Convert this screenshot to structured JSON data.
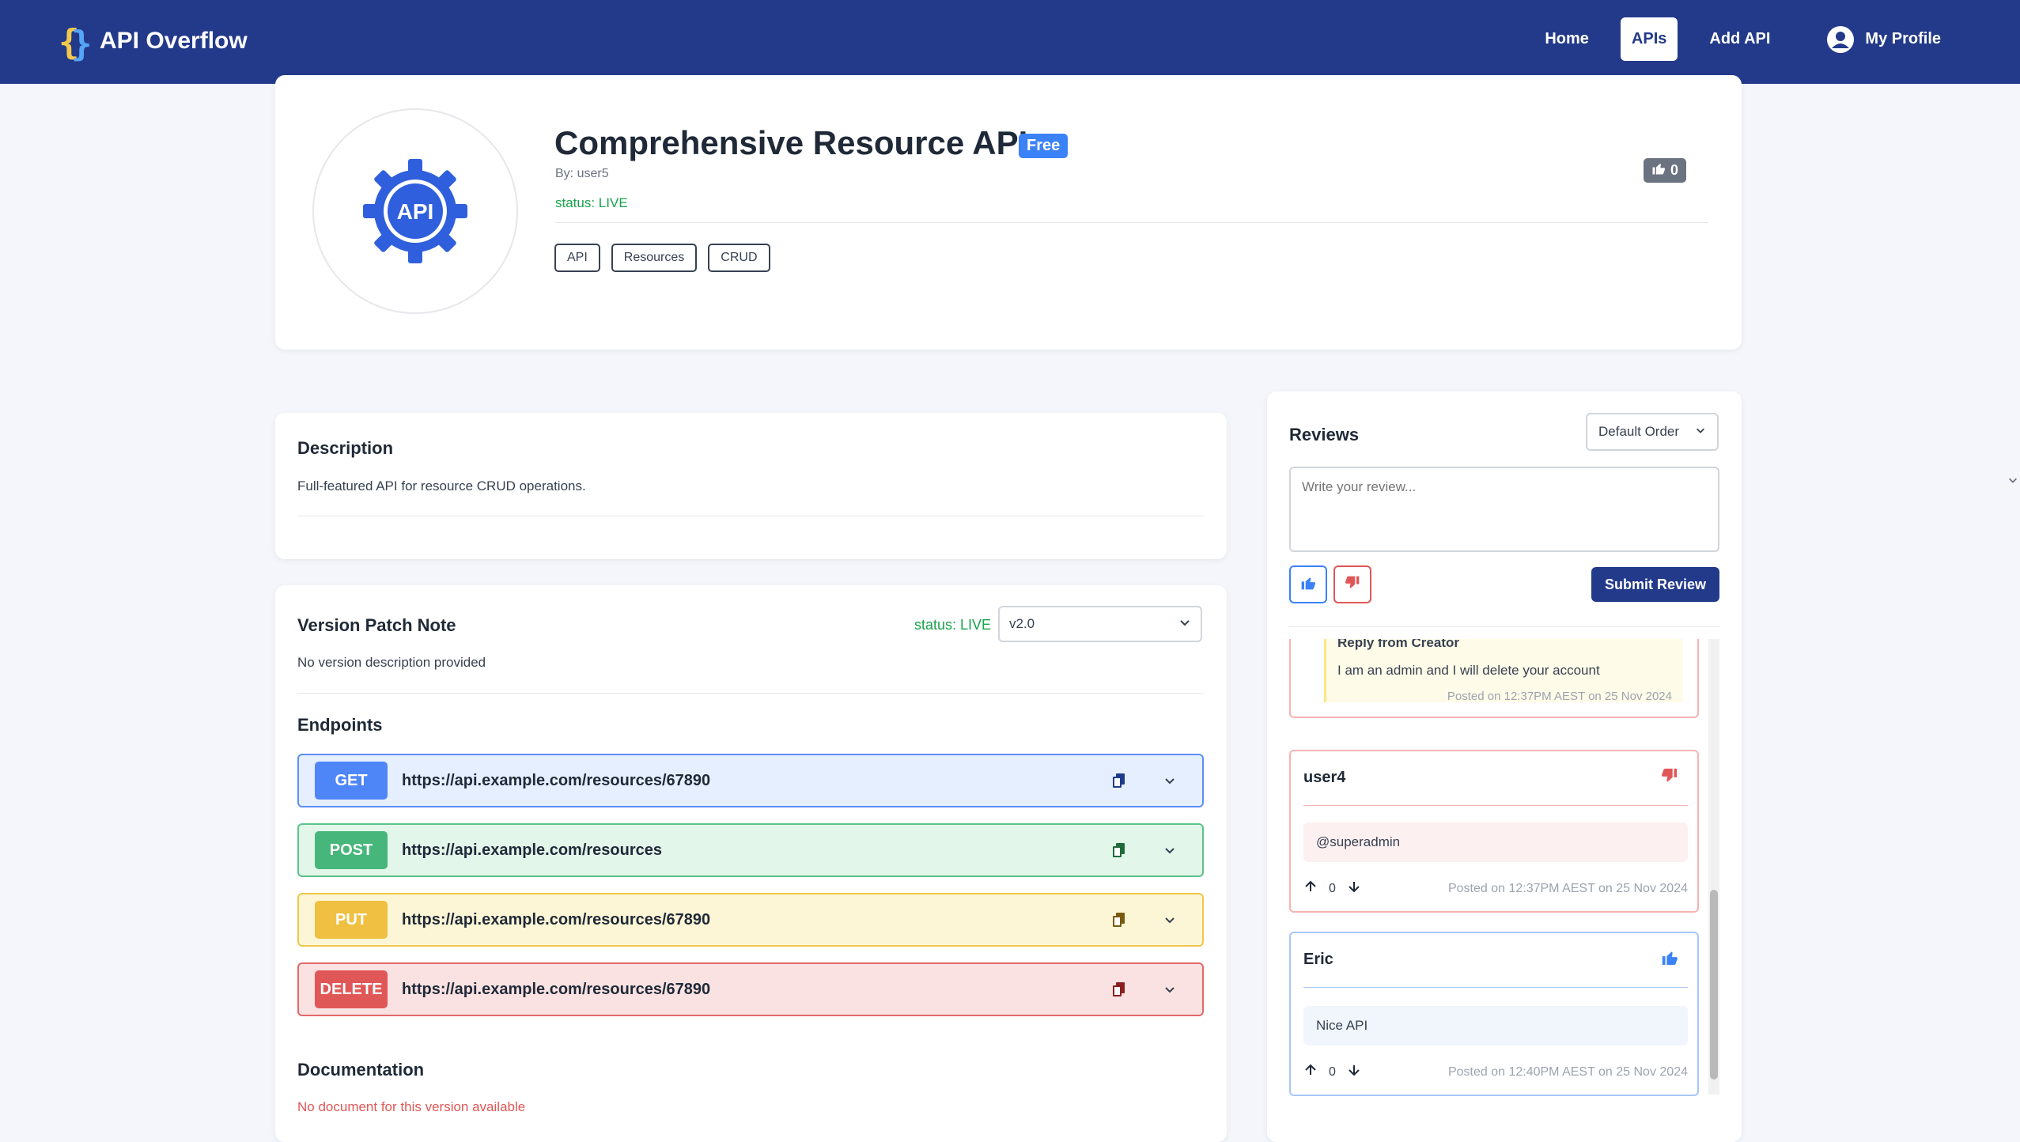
{
  "nav": {
    "brand": "API Overflow",
    "links": [
      "Home",
      "APIs",
      "Add API"
    ],
    "profile": "My Profile"
  },
  "api": {
    "title": "Comprehensive Resource API",
    "badge": "Free",
    "byline": "By: user5",
    "status": "status: LIVE",
    "likes": "0",
    "tags": [
      "API",
      "Resources",
      "CRUD"
    ],
    "logo_text": "API"
  },
  "description": {
    "heading": "Description",
    "text": "Full-featured API for resource CRUD operations."
  },
  "version": {
    "heading": "Version Patch Note",
    "status": "status: LIVE",
    "selected": "v2.0",
    "note": "No version description provided"
  },
  "endpoints": {
    "heading": "Endpoints",
    "items": [
      {
        "method": "GET",
        "url": "https://api.example.com/resources/67890",
        "color": "#4f86f7",
        "bg": "#e6efff",
        "border": "#5b8ff5"
      },
      {
        "method": "POST",
        "url": "https://api.example.com/resources",
        "color": "#46b67a",
        "bg": "#e2f6ea",
        "border": "#5cc48a"
      },
      {
        "method": "PUT",
        "url": "https://api.example.com/resources/67890",
        "color": "#f0c043",
        "bg": "#fdf6d6",
        "border": "#efc74a"
      },
      {
        "method": "DELETE",
        "url": "https://api.example.com/resources/67890",
        "color": "#e05757",
        "bg": "#fbe2e2",
        "border": "#e36868"
      }
    ]
  },
  "documentation": {
    "heading": "Documentation",
    "text": "No document for this version available"
  },
  "reviews": {
    "heading": "Reviews",
    "order": "Default Order",
    "placeholder": "Write your review...",
    "submit": "Submit Review",
    "reply": {
      "title": "Reply from Creator",
      "text": "I am an admin and I will delete your account",
      "posted": "Posted on 12:37PM AEST on 25 Nov 2024"
    },
    "items": [
      {
        "user": "user4",
        "body": "@superadmin",
        "votes": "0",
        "posted": "Posted on 12:37PM AEST on 25 Nov 2024",
        "sentiment": "negative"
      },
      {
        "user": "Eric",
        "body": "Nice API",
        "votes": "0",
        "posted": "Posted on 12:40PM AEST on 25 Nov 2024",
        "sentiment": "positive"
      }
    ]
  },
  "colors": {
    "navbar": "#233a8a",
    "live": "#16a34a",
    "free": "#3b82f6",
    "doc_missing": "#e05757"
  }
}
